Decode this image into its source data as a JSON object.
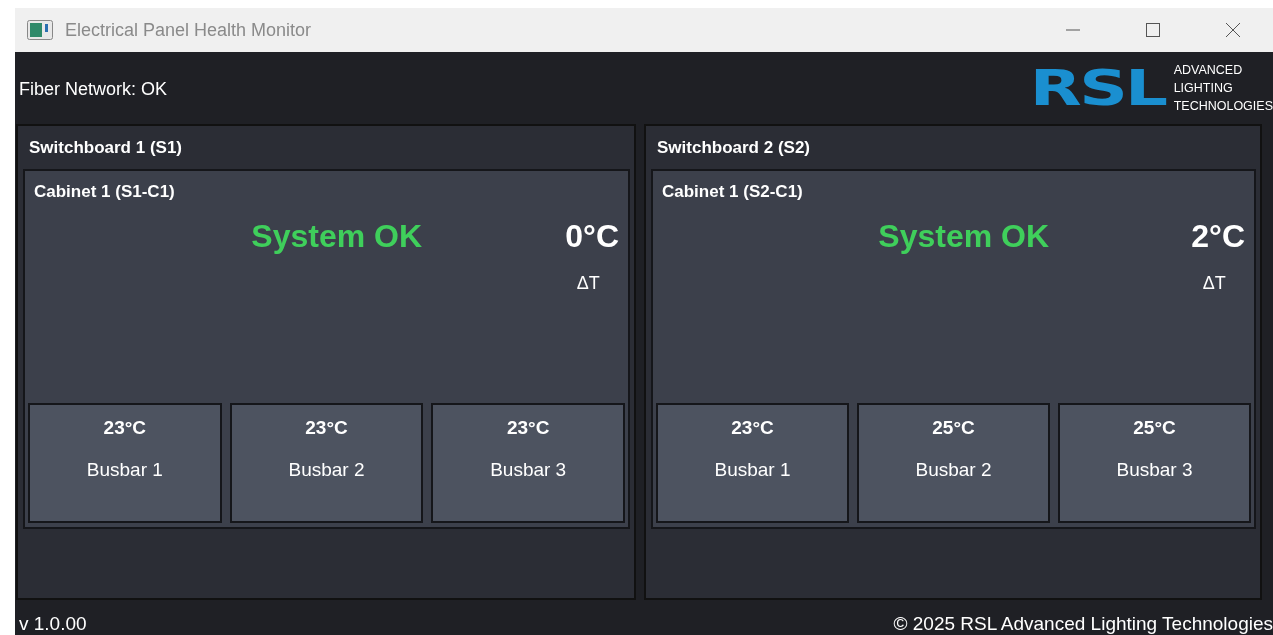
{
  "window": {
    "title": "Electrical Panel Health Monitor"
  },
  "header": {
    "network_status": "Fiber Network: OK",
    "logo": {
      "mark": "RSL",
      "tagline": [
        "ADVANCED",
        "LIGHTING",
        "TECHNOLOGIES"
      ]
    }
  },
  "switchboards": [
    {
      "title": "Switchboard 1 (S1)",
      "cabinets": [
        {
          "title": "Cabinet 1 (S1-C1)",
          "status": "System OK",
          "kind": "ok",
          "delta_temp": "0°C",
          "delta_label": "ΔT",
          "busbars": [
            {
              "temp": "23°C",
              "name": "Busbar 1"
            },
            {
              "temp": "23°C",
              "name": "Busbar 2"
            },
            {
              "temp": "23°C",
              "name": "Busbar 3"
            }
          ]
        }
      ]
    },
    {
      "title": "Switchboard 2 (S2)",
      "cabinets": [
        {
          "title": "Cabinet 1 (S2-C1)",
          "status": "System OK",
          "kind": "ok",
          "delta_temp": "2°C",
          "delta_label": "ΔT",
          "busbars": [
            {
              "temp": "23°C",
              "name": "Busbar 1"
            },
            {
              "temp": "25°C",
              "name": "Busbar 2"
            },
            {
              "temp": "25°C",
              "name": "Busbar 3"
            }
          ]
        }
      ]
    }
  ],
  "footer": {
    "version": "v 1.0.00",
    "copyright": "© 2025 RSL Advanced Lighting Technologies"
  }
}
